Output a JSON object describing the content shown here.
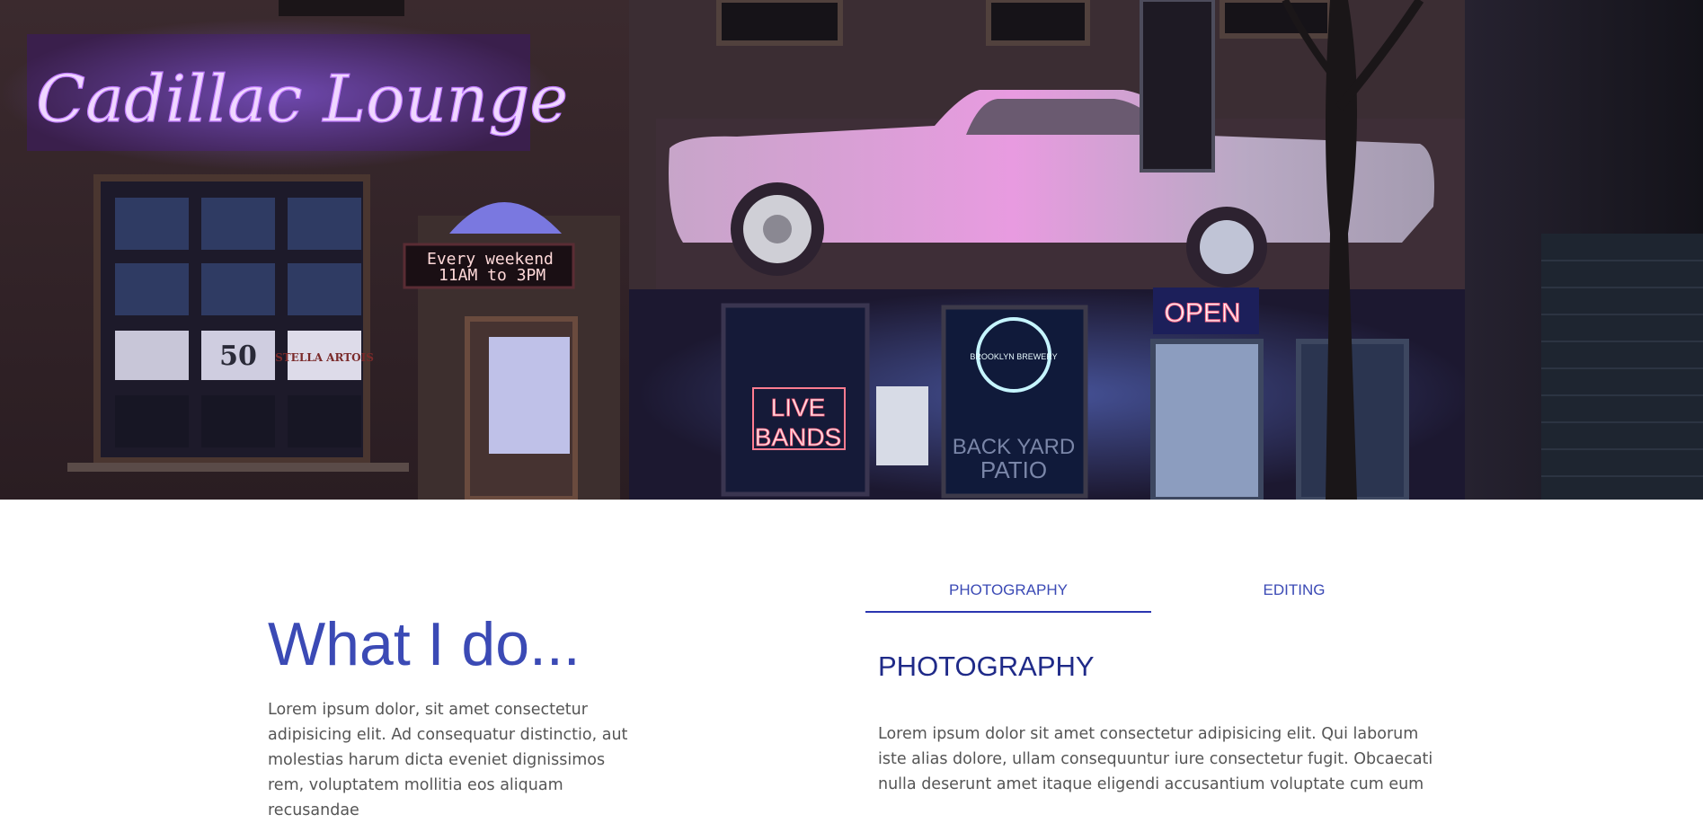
{
  "hero": {
    "image_alt": "Night street scene: Cadillac Lounge storefront with neon signs and a pink Cadillac car mounted on the facade",
    "sign_lounge": "Cadillac Lounge",
    "sign_led_line1": "Every weekend",
    "sign_led_line2": "11AM to 3PM",
    "sign_live": "LIVE",
    "sign_bands": "BANDS",
    "sign_open": "OPEN",
    "sign_brewery": "BROOKLYN BREWERY",
    "sign_patio_line1": "BACK YARD",
    "sign_patio_line2": "PATIO",
    "poster_stella": "STELLA ARTOIS",
    "poster_50": "50"
  },
  "section": {
    "heading": "What I do...",
    "intro": "Lorem ipsum dolor, sit amet consectetur adipisicing elit. Ad consequatur distinctio, aut molestias harum dicta eveniet dignissimos rem, voluptatem mollitia eos aliquam recusandae"
  },
  "tabs": [
    {
      "label": "PHOTOGRAPHY",
      "active": true
    },
    {
      "label": "EDITING",
      "active": false
    }
  ],
  "panel": {
    "title": "PHOTOGRAPHY",
    "text": "Lorem ipsum dolor sit amet consectetur adipisicing elit. Qui laborum iste alias dolore, ullam consequuntur iure consectetur fugit. Obcaecati nulla deserunt amet itaque eligendi accusantium voluptate cum eum"
  },
  "colors": {
    "accent": "#3b4ab5",
    "tab_underline": "#2b35b0",
    "panel_title": "#1f2a88",
    "body_text": "#555555",
    "neon_purple": "#c9a0ff",
    "neon_pink": "#ff8fb0",
    "neon_blue": "#8fb8ff"
  }
}
